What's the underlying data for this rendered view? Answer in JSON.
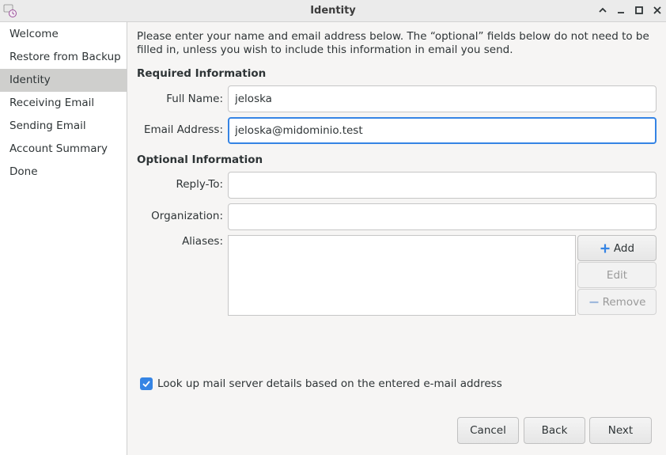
{
  "window": {
    "title": "Identity"
  },
  "sidebar": {
    "items": [
      {
        "label": "Welcome",
        "active": false
      },
      {
        "label": "Restore from Backup",
        "active": false
      },
      {
        "label": "Identity",
        "active": true
      },
      {
        "label": "Receiving Email",
        "active": false
      },
      {
        "label": "Sending Email",
        "active": false
      },
      {
        "label": "Account Summary",
        "active": false
      },
      {
        "label": "Done",
        "active": false
      }
    ]
  },
  "main": {
    "intro": "Please enter your name and email address below. The “optional” fields below do not need to be filled in, unless you wish to include this information in email you send.",
    "required_heading": "Required Information",
    "full_name": {
      "label": "Full Name:",
      "value": "jeloska"
    },
    "email": {
      "label": "Email Address:",
      "value": "jeloska@midominio.test"
    },
    "optional_heading": "Optional Information",
    "reply_to": {
      "label": "Reply-To:",
      "value": ""
    },
    "organization": {
      "label": "Organization:",
      "value": ""
    },
    "aliases": {
      "label": "Aliases:",
      "add_label": "Add",
      "edit_label": "Edit",
      "remove_label": "Remove"
    },
    "lookup_checkbox": {
      "label": "Look up mail server details based on the entered e-mail address",
      "checked": true
    }
  },
  "footer": {
    "cancel_label": "Cancel",
    "back_label": "Back",
    "next_label": "Next"
  },
  "colors": {
    "accent": "#3584e4",
    "sidebar_selected": "#cfcfcd"
  }
}
